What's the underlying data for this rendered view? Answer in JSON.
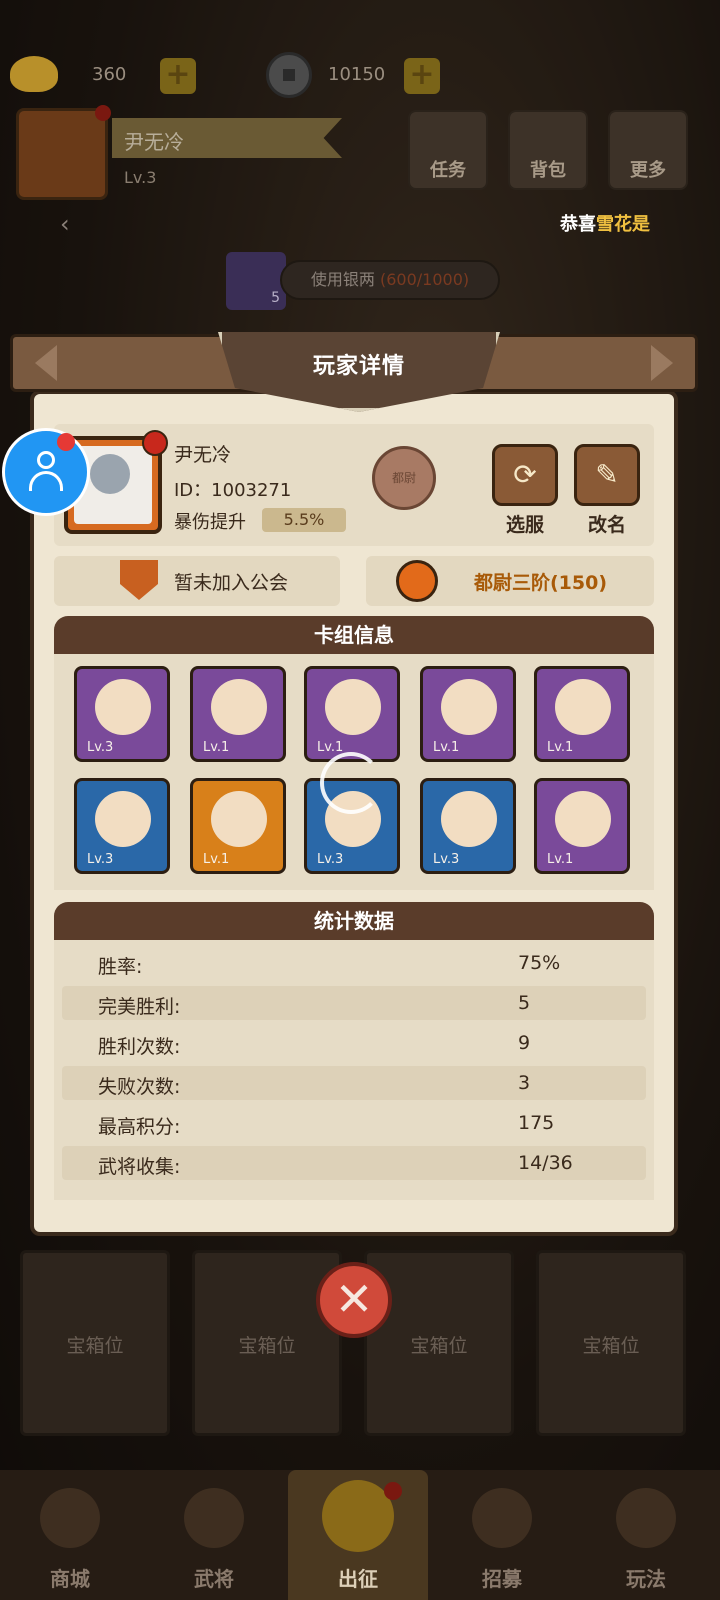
{
  "currency": {
    "ingot": "360",
    "coins": "10150"
  },
  "player_top": {
    "name": "尹无冷",
    "level": "Lv.3"
  },
  "top_buttons": [
    {
      "label": "任务",
      "icon": "scroll-icon"
    },
    {
      "label": "背包",
      "icon": "bag-icon"
    },
    {
      "label": "更多",
      "icon": "menu-icon"
    }
  ],
  "marquee": {
    "prefix": "恭喜",
    "highlight": "雪花是",
    "suffix": ""
  },
  "silver": {
    "count": "5",
    "label": "使用银两",
    "cost": "(600/1000)"
  },
  "dialog": {
    "title": "玩家详情",
    "name": "尹无冷",
    "id": "ID：1003271",
    "crit_label": "暴伤提升",
    "crit_value": "5.5%",
    "rank_emblem": "都尉",
    "btn_outfit": "选服",
    "btn_rename": "改名",
    "guild": "暂未加入公会",
    "rank": "都尉三阶(150)",
    "deck_title": "卡组信息",
    "cards": [
      {
        "level": "Lv.3",
        "rarity": "purple"
      },
      {
        "level": "Lv.1",
        "rarity": "purple"
      },
      {
        "level": "Lv.1",
        "rarity": "purple"
      },
      {
        "level": "Lv.1",
        "rarity": "purple"
      },
      {
        "level": "Lv.1",
        "rarity": "purple"
      },
      {
        "level": "Lv.3",
        "rarity": "blue"
      },
      {
        "level": "Lv.1",
        "rarity": "orange"
      },
      {
        "level": "Lv.3",
        "rarity": "blue"
      },
      {
        "level": "Lv.3",
        "rarity": "blue"
      },
      {
        "level": "Lv.1",
        "rarity": "purple"
      }
    ],
    "stats_title": "统计数据",
    "stats": [
      {
        "label": "胜率:",
        "value": "75%"
      },
      {
        "label": "完美胜利:",
        "value": "5"
      },
      {
        "label": "胜利次数:",
        "value": "9"
      },
      {
        "label": "失败次数:",
        "value": "3"
      },
      {
        "label": "最高积分:",
        "value": "175"
      },
      {
        "label": "武将收集:",
        "value": "14/36"
      }
    ]
  },
  "chests": [
    "宝箱位",
    "宝箱位",
    "宝箱位",
    "宝箱位"
  ],
  "nav": [
    {
      "label": "商城",
      "active": false
    },
    {
      "label": "武将",
      "active": false
    },
    {
      "label": "出征",
      "active": true
    },
    {
      "label": "招募",
      "active": false
    },
    {
      "label": "玩法",
      "active": false
    }
  ],
  "colors": {
    "accent_gold": "#f0c040",
    "rank_text": "#a85a08",
    "close_red": "#d04a3a",
    "assistant_blue": "#2196f3"
  }
}
